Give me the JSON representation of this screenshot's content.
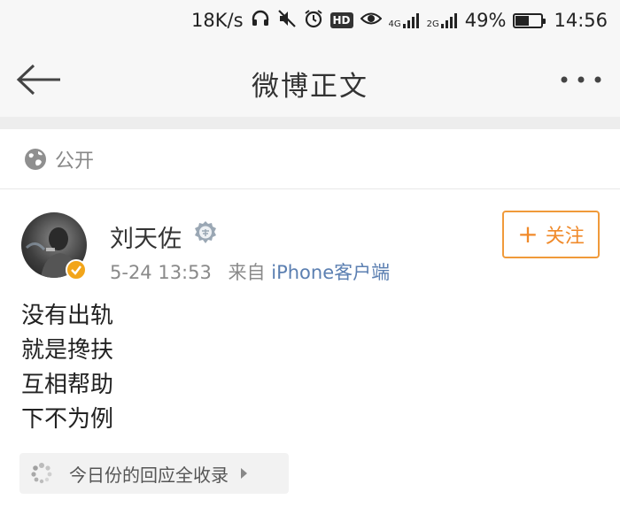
{
  "status_bar": {
    "net_speed": "18K/s",
    "network_4g": "4G",
    "network_2g": "2G",
    "battery_percent": "49%",
    "battery_level": 0.49,
    "time": "14:56",
    "hd_label": "HD",
    "icons": [
      "headphones-icon",
      "mute-icon",
      "alarm-icon",
      "hd-icon",
      "eye-icon",
      "signal-icon",
      "battery-icon"
    ]
  },
  "nav": {
    "title": "微博正文",
    "back_icon": "back-arrow-icon",
    "more_icon": "more-dots-icon"
  },
  "visibility": {
    "icon": "globe-icon",
    "label": "公开"
  },
  "post": {
    "username": "刘天佐",
    "timestamp": "5-24 13:53",
    "from_label": "来自",
    "source": "iPhone客户端",
    "follow_label": "关注",
    "lines": [
      "没有出轨",
      "就是搀扶",
      "互相帮助",
      "下不为例"
    ]
  },
  "responses": {
    "label": "今日份的回应全收录"
  },
  "colors": {
    "accent_orange": "#f08a2a",
    "link_blue": "#5b7fb1",
    "verified_gold": "#f2a51a"
  }
}
